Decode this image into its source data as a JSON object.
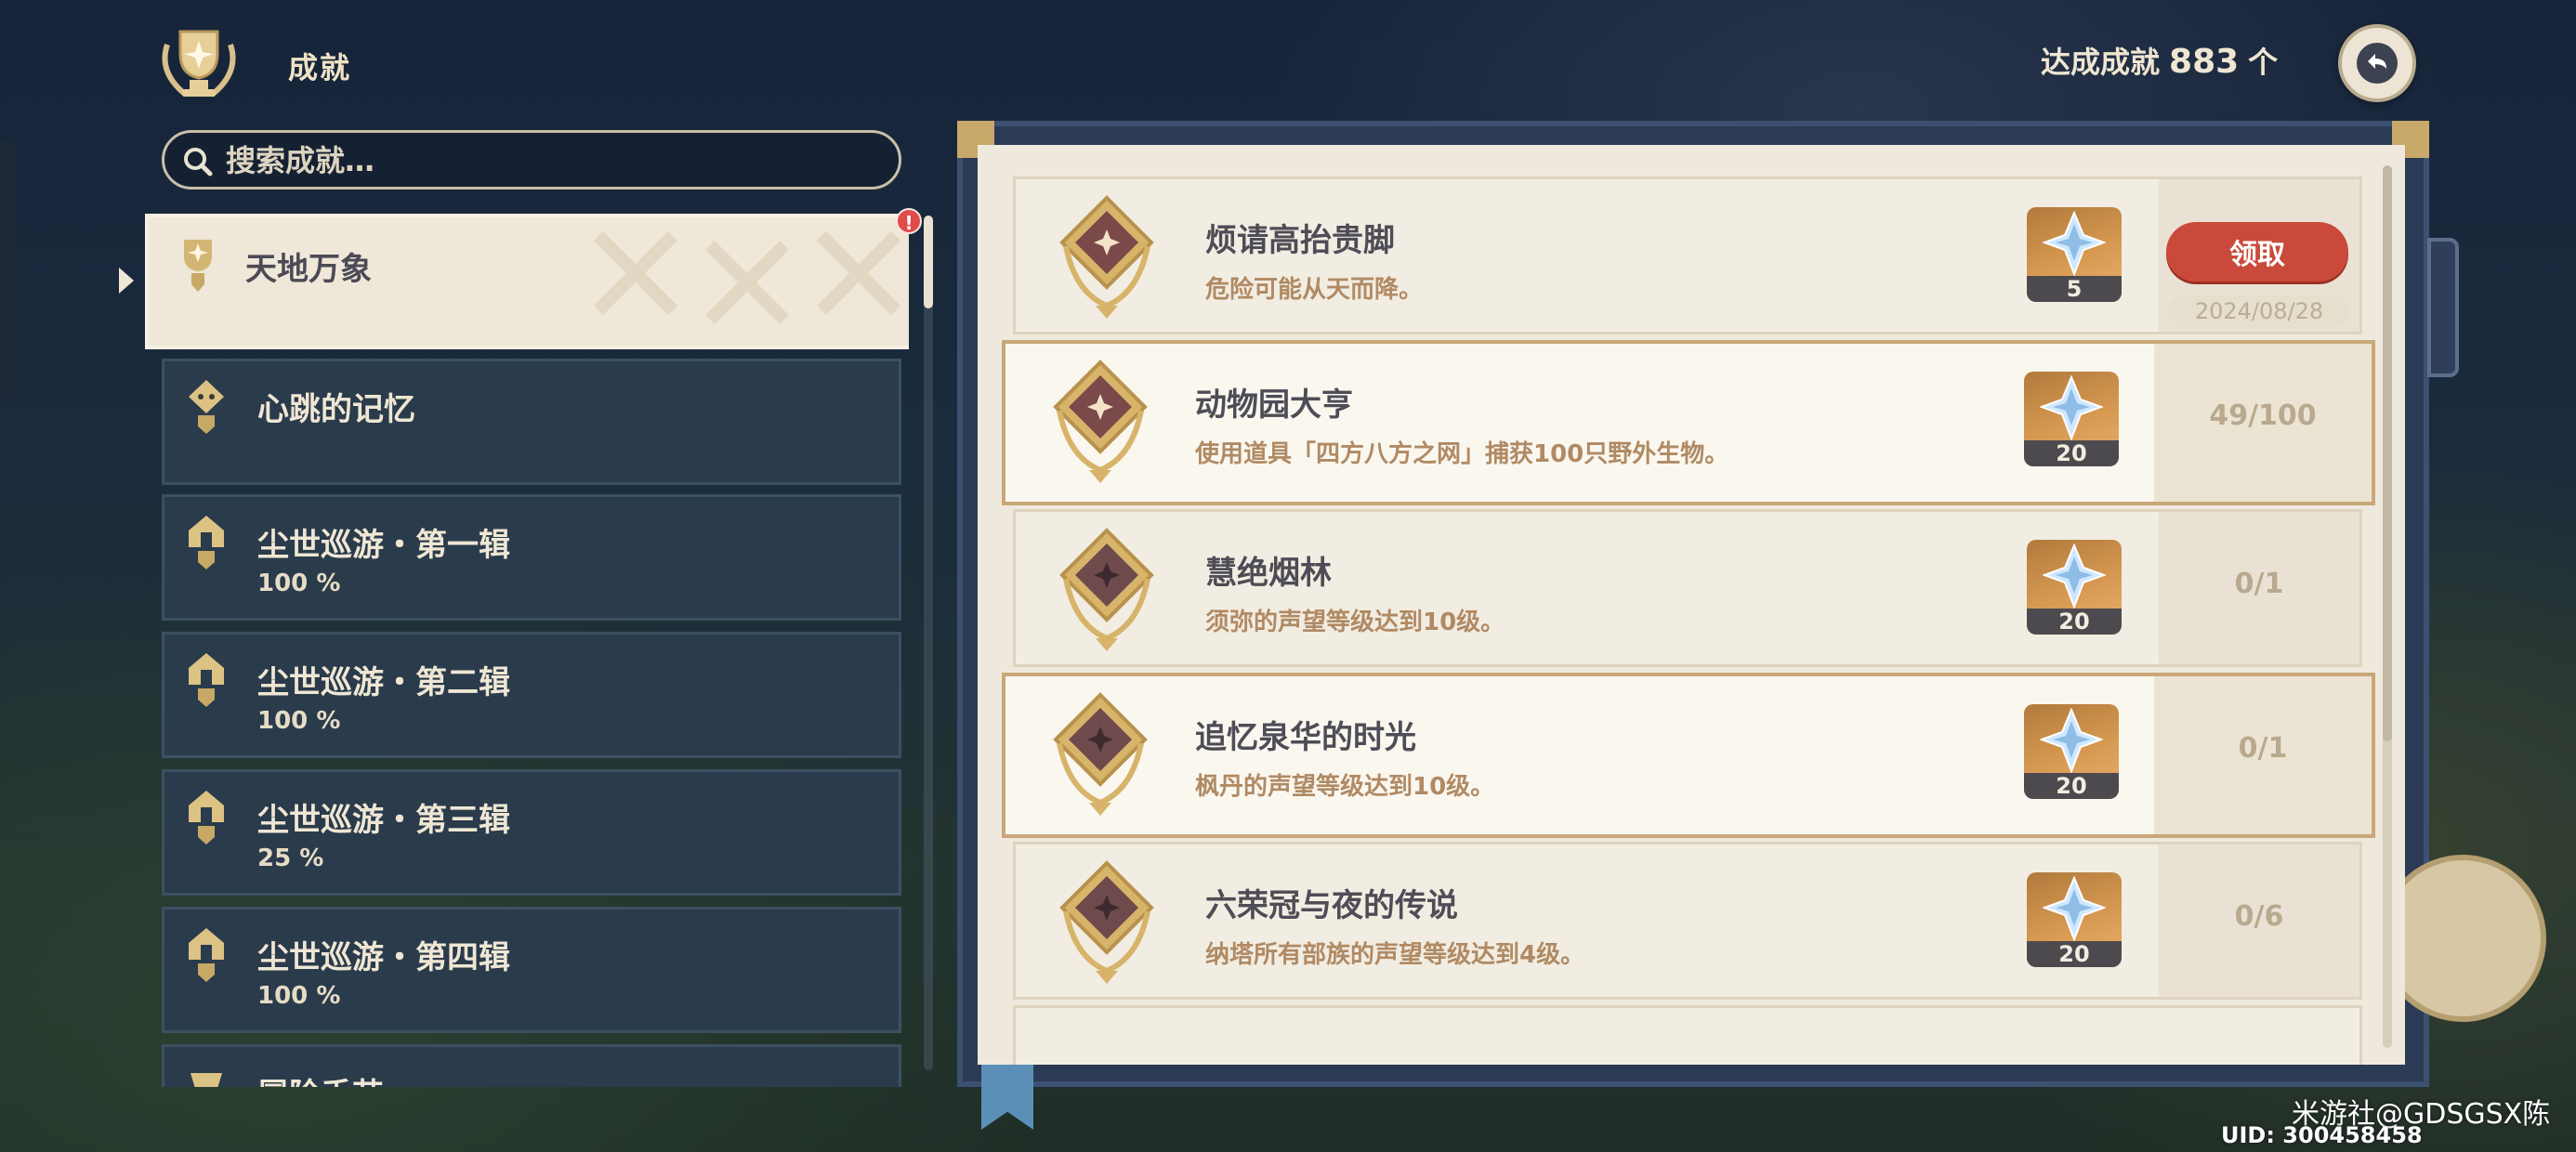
{
  "header": {
    "title": "成就",
    "count_label": "达成成就",
    "count_value": "883",
    "count_unit": "个"
  },
  "search": {
    "placeholder": "搜索成就…"
  },
  "categories": [
    {
      "name": "天地万象",
      "percent": "",
      "active": true,
      "has_notification": true
    },
    {
      "name": "心跳的记忆",
      "percent": ""
    },
    {
      "name": "尘世巡游・第一辑",
      "percent": "100 %"
    },
    {
      "name": "尘世巡游・第二辑",
      "percent": "100 %"
    },
    {
      "name": "尘世巡游・第三辑",
      "percent": "25 %"
    },
    {
      "name": "尘世巡游・第四辑",
      "percent": "100 %"
    },
    {
      "name": "冒险手艺",
      "percent": ""
    }
  ],
  "notification_mark": "!",
  "achievements": [
    {
      "title": "烦请高抬贵脚",
      "desc": "危险可能从天而降。",
      "reward": "5",
      "claim_label": "领取",
      "date": "2024/08/28"
    },
    {
      "title": "动物园大亨",
      "desc": "使用道具「四方八方之网」捕获100只野外生物。",
      "reward": "20",
      "progress": "49/100"
    },
    {
      "title": "慧绝烟林",
      "desc": "须弥的声望等级达到10级。",
      "reward": "20",
      "progress": "0/1"
    },
    {
      "title": "追忆泉华的时光",
      "desc": "枫丹的声望等级达到10级。",
      "reward": "20",
      "progress": "0/1"
    },
    {
      "title": "六荣冠与夜的传说",
      "desc": "纳塔所有部族的声望等级达到4级。",
      "reward": "20",
      "progress": "0/6"
    }
  ],
  "watermark": "米游社@GDSGSX陈",
  "uid": "UID: 300458458",
  "colors": {
    "claim_button": "#c94a3b",
    "highlight_border": "#c9a779",
    "reward_bg": "#d89a52"
  }
}
